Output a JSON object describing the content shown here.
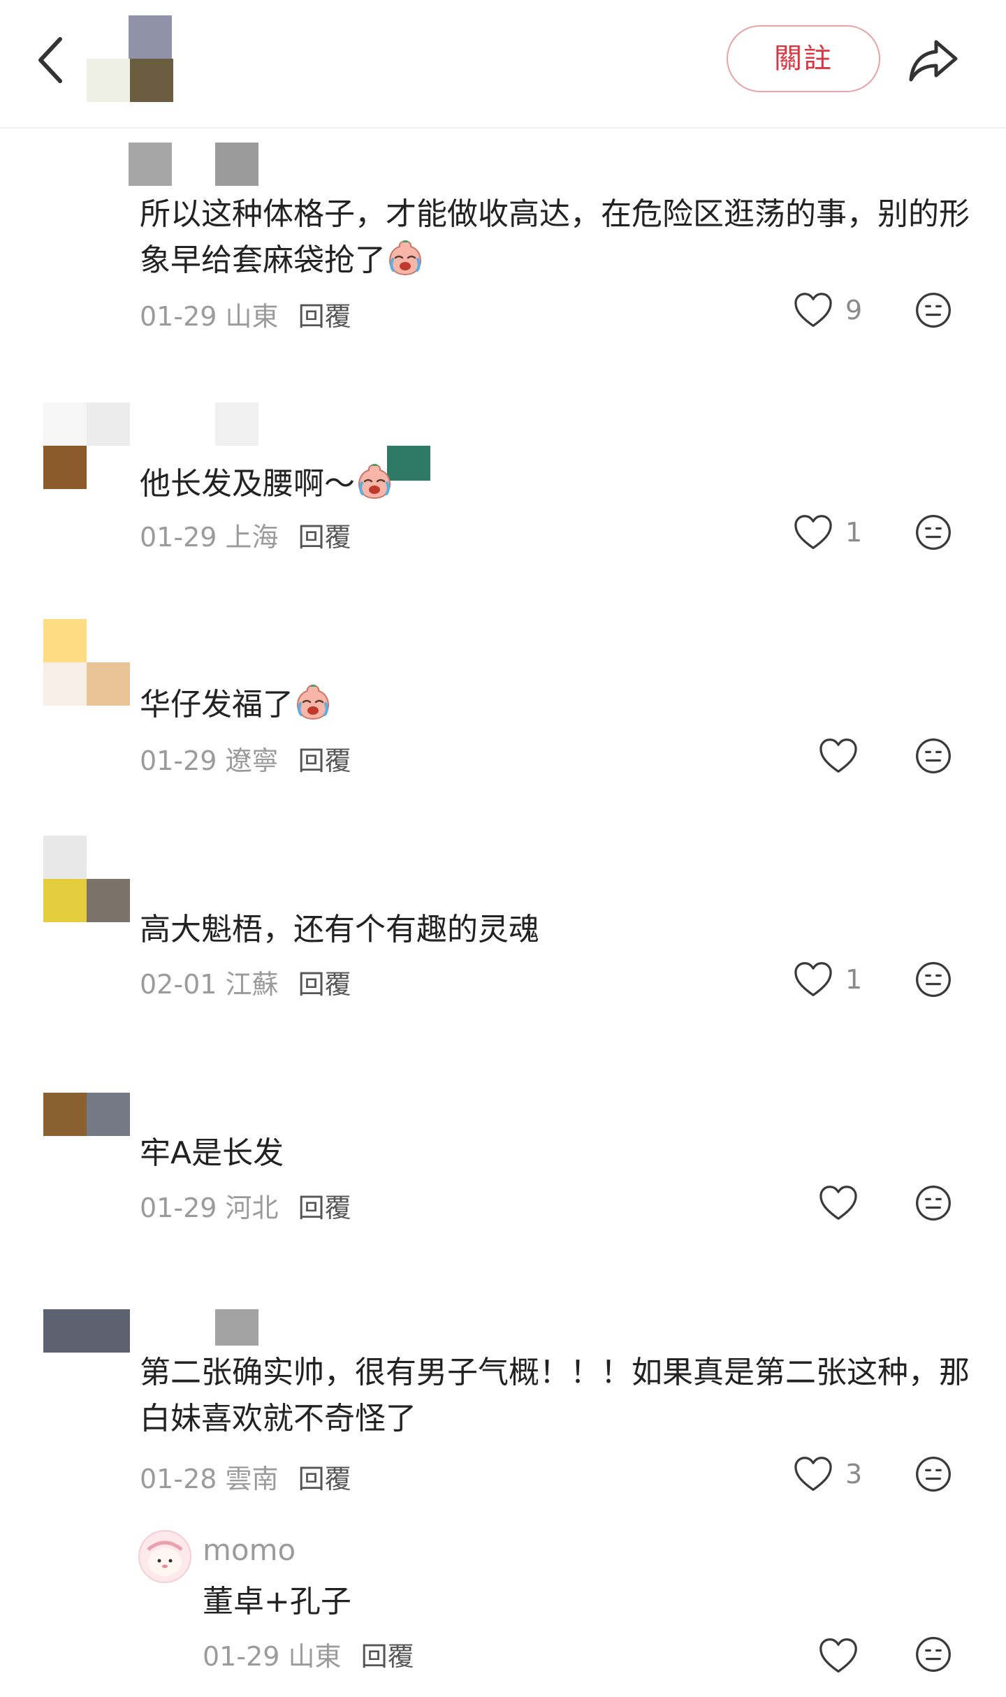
{
  "header": {
    "follow_label": "關註"
  },
  "colors": {
    "accent": "#d9343f",
    "meta": "#9b9b9b",
    "text": "#222222"
  },
  "comments": [
    {
      "text": "所以这种体格子，才能做收高达，在危险区逛荡的事，别的形象早给套麻袋抢了",
      "date": "01-29",
      "location": "山東",
      "reply_label": "回覆",
      "likes": "9",
      "has_emoji": true
    },
    {
      "text": "他长发及腰啊～",
      "date": "01-29",
      "location": "上海",
      "reply_label": "回覆",
      "likes": "1",
      "has_emoji": true
    },
    {
      "text": "华仔发福了",
      "date": "01-29",
      "location": "遼寧",
      "reply_label": "回覆",
      "likes": "",
      "has_emoji": true
    },
    {
      "text": "高大魁梧，还有个有趣的灵魂",
      "date": "02-01",
      "location": "江蘇",
      "reply_label": "回覆",
      "likes": "1",
      "has_emoji": false
    },
    {
      "text": "牢A是长发",
      "date": "01-29",
      "location": "河北",
      "reply_label": "回覆",
      "likes": "",
      "has_emoji": false
    },
    {
      "text": "第二张确实帅，很有男子气概！！！如果真是第二张这种，那白妹喜欢就不奇怪了",
      "date": "01-28",
      "location": "雲南",
      "reply_label": "回覆",
      "likes": "3",
      "has_emoji": false
    }
  ],
  "sub_reply": {
    "username": "momo",
    "text": "董卓+孔子",
    "date": "01-29",
    "location": "山東",
    "reply_label": "回覆"
  },
  "icons": [
    "back-chevron-icon",
    "share-icon",
    "heart-icon",
    "reaction-face-icon",
    "crying-emoji-icon"
  ]
}
